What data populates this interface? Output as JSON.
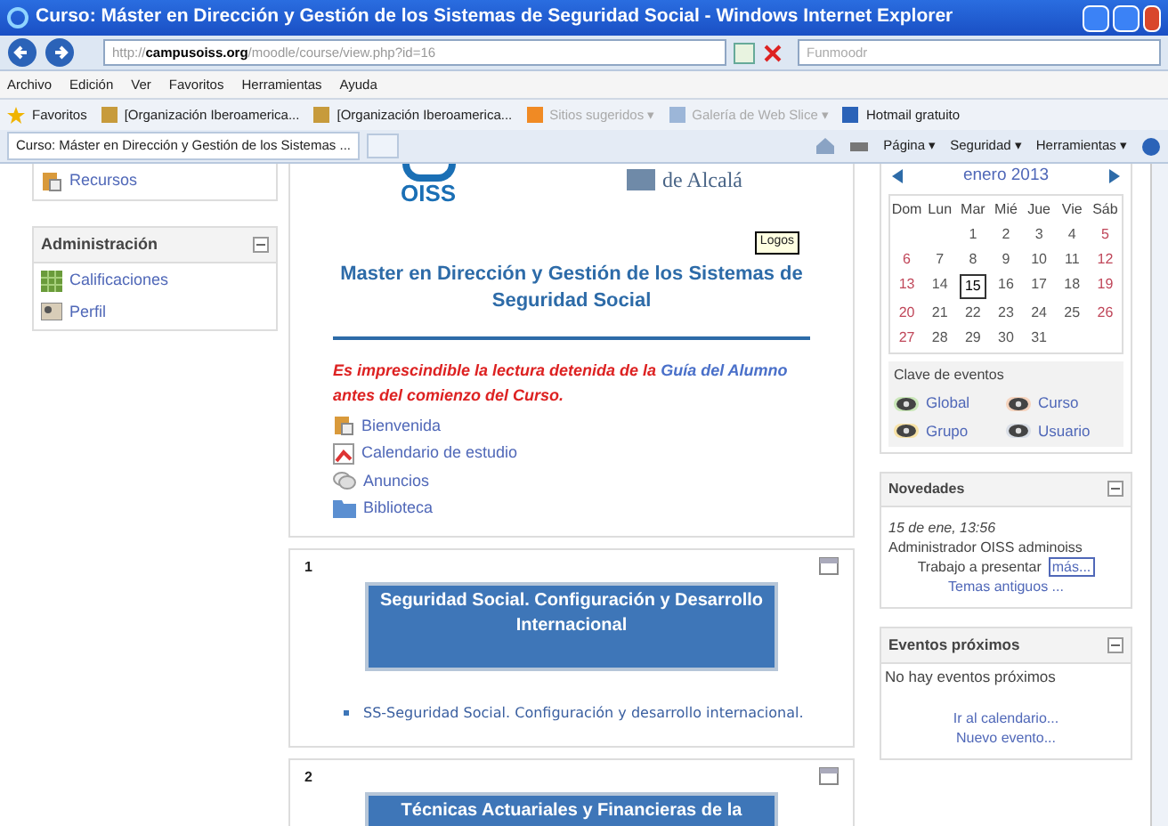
{
  "window": {
    "title": "Curso: Máster en Dirección y Gestión de los Sistemas de Seguridad Social - Windows Internet Explorer"
  },
  "address": {
    "scheme": "http://",
    "domain": "campusoiss.org",
    "path": "/moodle/course/view.php?id=16"
  },
  "search": {
    "value": "Funmoodr"
  },
  "menu": [
    "Archivo",
    "Edición",
    "Ver",
    "Favoritos",
    "Herramientas",
    "Ayuda"
  ],
  "favorites_bar": {
    "label": "Favoritos",
    "items": [
      {
        "kind": "page",
        "label": "[Organización Iberoamerica...",
        "disabled": false
      },
      {
        "kind": "page",
        "label": "[Organización Iberoamerica...",
        "disabled": false
      },
      {
        "kind": "suggested",
        "label": "Sitios sugeridos ▾",
        "disabled": true
      },
      {
        "kind": "slice",
        "label": "Galería de Web Slice ▾",
        "disabled": true
      },
      {
        "kind": "hotmail",
        "label": "Hotmail gratuito",
        "disabled": false
      }
    ]
  },
  "tab": {
    "label": "Curso: Máster en Dirección y Gestión de los Sistemas ..."
  },
  "command_bar": [
    "Página ▾",
    "Seguridad ▾",
    "Herramientas ▾"
  ],
  "left_blocks": [
    {
      "items": [
        {
          "kind": "resources",
          "label": "Recursos"
        }
      ]
    },
    {
      "title": "Administración",
      "items": [
        {
          "kind": "grades",
          "label": "Calificaciones"
        },
        {
          "kind": "profile",
          "label": "Perfil"
        }
      ]
    }
  ],
  "course": {
    "logo_left": "OISS",
    "logo_right": "de Alcalá",
    "logos_tooltip": "Logos",
    "title": "Master en Dirección y Gestión de los Sistemas de Seguridad Social",
    "notice": {
      "before": "Es imprescindible la lectura detenida de la",
      "link": "Guía del Alumno",
      "after": "antes del comienzo del Curso."
    },
    "links": [
      {
        "kind": "resources",
        "label": "Bienvenida"
      },
      {
        "kind": "calendar",
        "label": "Calendario de estudio"
      },
      {
        "kind": "forum",
        "label": "Anuncios"
      },
      {
        "kind": "folder",
        "label": "Biblioteca"
      }
    ]
  },
  "sections": [
    {
      "number": "1",
      "banner": "Seguridad Social. Configuración y Desarrollo Internacional",
      "items": [
        "SS-Seguridad Social. Configuración y desarrollo internacional."
      ]
    },
    {
      "number": "2",
      "banner": "Técnicas Actuariales y Financieras de la"
    }
  ],
  "calendar": {
    "month": "enero 2013",
    "weekdays": [
      "Dom",
      "Lun",
      "Mar",
      "Mié",
      "Jue",
      "Vie",
      "Sáb"
    ],
    "weeks": [
      [
        {
          "day": "1",
          "weekend": false,
          "today": false
        },
        {
          "day": "2",
          "weekend": false,
          "today": false
        },
        {
          "day": "3",
          "weekend": false,
          "today": false
        },
        {
          "day": "4",
          "weekend": false,
          "today": false
        },
        {
          "day": "5",
          "weekend": true,
          "today": false
        }
      ],
      [
        {
          "day": "6",
          "weekend": true,
          "today": false
        },
        {
          "day": "7",
          "weekend": false,
          "today": false
        },
        {
          "day": "8",
          "weekend": false,
          "today": false
        },
        {
          "day": "9",
          "weekend": false,
          "today": false
        },
        {
          "day": "10",
          "weekend": false,
          "today": false
        },
        {
          "day": "11",
          "weekend": false,
          "today": false
        },
        {
          "day": "12",
          "weekend": true,
          "today": false
        }
      ],
      [
        {
          "day": "13",
          "weekend": true,
          "today": false
        },
        {
          "day": "14",
          "weekend": false,
          "today": false
        },
        {
          "day": "15",
          "weekend": false,
          "today": true
        },
        {
          "day": "16",
          "weekend": false,
          "today": false
        },
        {
          "day": "17",
          "weekend": false,
          "today": false
        },
        {
          "day": "18",
          "weekend": false,
          "today": false
        },
        {
          "day": "19",
          "weekend": true,
          "today": false
        }
      ],
      [
        {
          "day": "20",
          "weekend": true,
          "today": false
        },
        {
          "day": "21",
          "weekend": false,
          "today": false
        },
        {
          "day": "22",
          "weekend": false,
          "today": false
        },
        {
          "day": "23",
          "weekend": false,
          "today": false
        },
        {
          "day": "24",
          "weekend": false,
          "today": false
        },
        {
          "day": "25",
          "weekend": false,
          "today": false
        },
        {
          "day": "26",
          "weekend": true,
          "today": false
        }
      ],
      [
        {
          "day": "27",
          "weekend": true,
          "today": false
        },
        {
          "day": "28",
          "weekend": false,
          "today": false
        },
        {
          "day": "29",
          "weekend": false,
          "today": false
        },
        {
          "day": "30",
          "weekend": false,
          "today": false
        },
        {
          "day": "31",
          "weekend": false,
          "today": false
        }
      ]
    ],
    "key_title": "Clave de eventos",
    "key": [
      {
        "label": "Global",
        "color": "#c9e6b8"
      },
      {
        "label": "Curso",
        "color": "#f5d3bd"
      },
      {
        "label": "Grupo",
        "color": "#f7e2a6"
      },
      {
        "label": "Usuario",
        "color": "#d9dee6"
      }
    ]
  },
  "news": {
    "title": "Novedades",
    "date": "15 de ene, 13:56",
    "author": "Administrador OISS adminoiss",
    "post": "Trabajo a presentar",
    "more": "más...",
    "older": "Temas antiguos ..."
  },
  "events": {
    "title": "Eventos próximos",
    "empty": "No hay eventos próximos",
    "links": [
      "Ir al calendario...",
      "Nuevo evento..."
    ]
  }
}
